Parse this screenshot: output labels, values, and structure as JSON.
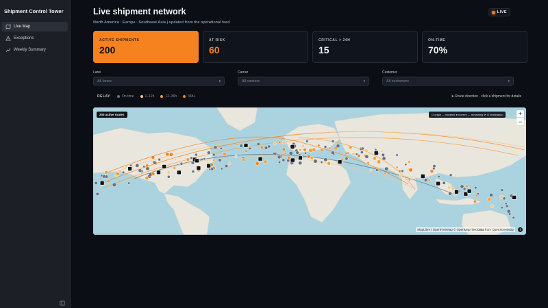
{
  "app": {
    "title": "Shipment Control Tower"
  },
  "sidebar": {
    "items": [
      {
        "label": "Live Map",
        "icon": "map-icon",
        "active": true
      },
      {
        "label": "Exceptions",
        "icon": "warning-icon",
        "active": false
      },
      {
        "label": "Weekly Summary",
        "icon": "chart-icon",
        "active": false
      }
    ]
  },
  "header": {
    "title": "Live shipment network",
    "live_label": "LIVE",
    "subtitle": "North America · Europe · Southeast Asia | updated from the operational feed"
  },
  "kpis": [
    {
      "label": "ACTIVE SHIPMENTS",
      "value": "200"
    },
    {
      "label": "AT RISK",
      "value": "60"
    },
    {
      "label": "CRITICAL > 24H",
      "value": "15"
    },
    {
      "label": "ON-TIME",
      "value": "70%"
    }
  ],
  "filters": {
    "lane": {
      "label": "Lane",
      "value": "All lanes"
    },
    "carrier": {
      "label": "Carrier",
      "value": "All carriers"
    },
    "customer": {
      "label": "Customer",
      "value": "All customers"
    }
  },
  "legend": {
    "title": "DELAY",
    "items": [
      {
        "label": "On time",
        "color": "#6b7280"
      },
      {
        "label": "1–12h",
        "color": "#f3c98b"
      },
      {
        "label": "12–36h",
        "color": "#f59e3b"
      },
      {
        "label": "36h+",
        "color": "#f6821f"
      }
    ],
    "route_hint": "➤ Route direction · click a shipment for details"
  },
  "map": {
    "badge": "200 active routes",
    "legend_text": "O origin — traveled ● current — remaining ➤ O destination",
    "zoom_in": "+",
    "zoom_out": "−",
    "attribution_prefix": "MapLibre | OpenFreeMap © OpenMapTiles ",
    "attribution_bold": "Data",
    "attribution_suffix": " from OpenStreetMap",
    "info": "i"
  },
  "colors": {
    "accent": "#f6821f",
    "background": "#0b0e14",
    "ocean": "#aad3df",
    "land": "#e9e6dd"
  }
}
